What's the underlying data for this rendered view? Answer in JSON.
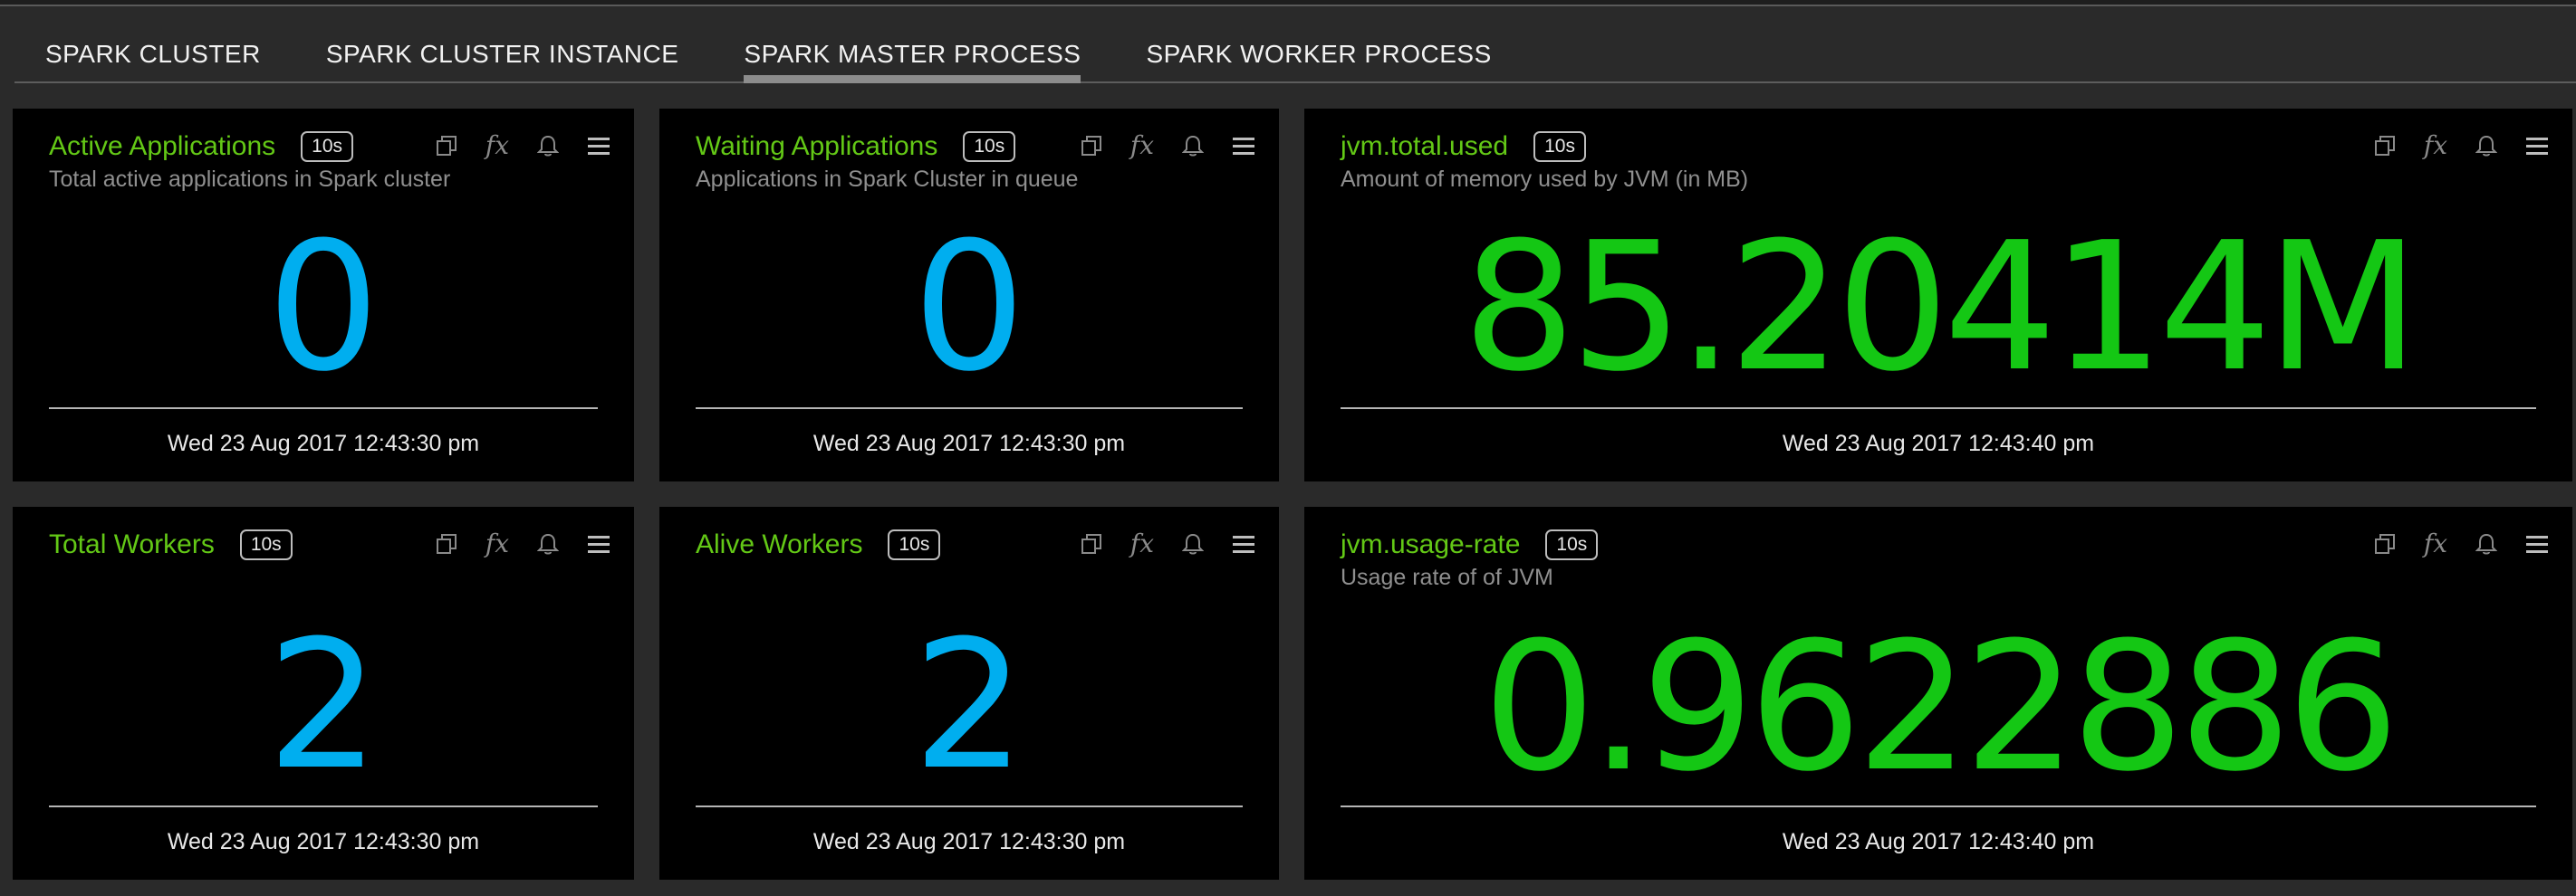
{
  "tabs": [
    {
      "label": "SPARK CLUSTER",
      "active": false
    },
    {
      "label": "SPARK CLUSTER INSTANCE",
      "active": false
    },
    {
      "label": "SPARK MASTER PROCESS",
      "active": true
    },
    {
      "label": "SPARK WORKER PROCESS",
      "active": false
    }
  ],
  "colors": {
    "title": "#63c816",
    "value_blue": "#00aeef",
    "value_green": "#14c714"
  },
  "panels": {
    "active_apps": {
      "title": "Active Applications",
      "interval": "10s",
      "subtitle": "Total active applications in Spark cluster",
      "value": "0",
      "timestamp": "Wed 23 Aug 2017 12:43:30 pm"
    },
    "waiting_apps": {
      "title": "Waiting Applications",
      "interval": "10s",
      "subtitle": "Applications in Spark Cluster in queue",
      "value": "0",
      "timestamp": "Wed 23 Aug 2017 12:43:30 pm"
    },
    "jvm_total_used": {
      "title": "jvm.total.used",
      "interval": "10s",
      "subtitle": "Amount of memory used by JVM (in MB)",
      "value": "85.20414M",
      "timestamp": "Wed 23 Aug 2017 12:43:40 pm"
    },
    "total_workers": {
      "title": "Total Workers",
      "interval": "10s",
      "subtitle": "",
      "value": "2",
      "timestamp": "Wed 23 Aug 2017 12:43:30 pm"
    },
    "alive_workers": {
      "title": "Alive Workers",
      "interval": "10s",
      "subtitle": "",
      "value": "2",
      "timestamp": "Wed 23 Aug 2017 12:43:30 pm"
    },
    "jvm_usage_rate": {
      "title": "jvm.usage-rate",
      "interval": "10s",
      "subtitle": "Usage rate of of JVM",
      "value": "0.9622886",
      "timestamp": "Wed 23 Aug 2017 12:43:40 pm"
    }
  },
  "tool_icons": [
    "copy-icon",
    "fx-icon",
    "bell-icon",
    "menu-icon"
  ],
  "fx_label": "fx"
}
